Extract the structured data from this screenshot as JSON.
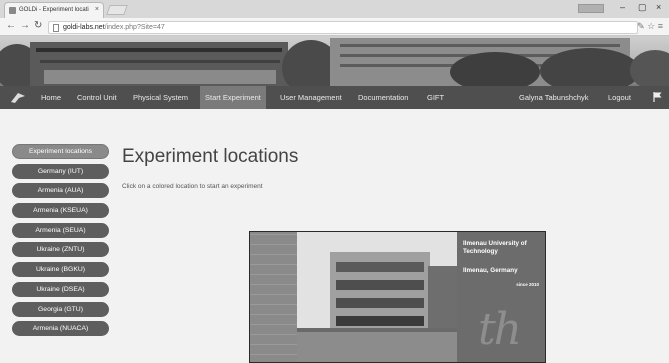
{
  "browser": {
    "tab_title": "GOLDi - Experiment locati",
    "tab_close": "×",
    "url_host": "goldi-labs.net",
    "url_path": "/index.php?Site=47",
    "window_controls": [
      "–",
      "▢",
      "×"
    ]
  },
  "nav": {
    "items": [
      "Home",
      "Control Unit",
      "Physical System",
      "Start Experiment",
      "User Management",
      "Documentation",
      "GIFT"
    ],
    "active_item": "Start Experiment",
    "user_name": "Galyna Tabunshchyk",
    "logout": "Logout"
  },
  "sidebar": {
    "items": [
      {
        "label": "Experiment locations",
        "active": true
      },
      {
        "label": "Germany (IUT)",
        "active": false
      },
      {
        "label": "Armenia (AUA)",
        "active": false
      },
      {
        "label": "Armenia (KSEUA)",
        "active": false
      },
      {
        "label": "Armenia (SEUA)",
        "active": false
      },
      {
        "label": "Ukraine (ZNTU)",
        "active": false
      },
      {
        "label": "Ukraine (BGKU)",
        "active": false
      },
      {
        "label": "Ukraine (DSEA)",
        "active": false
      },
      {
        "label": "Georgia (GTU)",
        "active": false
      },
      {
        "label": "Armenia (NUACA)",
        "active": false
      }
    ]
  },
  "main": {
    "title": "Experiment locations",
    "instruction": "Click on a colored location to start an experiment"
  },
  "location_card": {
    "university": "Ilmenau University of Technology",
    "city": "Ilmenau, Germany",
    "since": "since 2010",
    "logo_text": "th"
  }
}
